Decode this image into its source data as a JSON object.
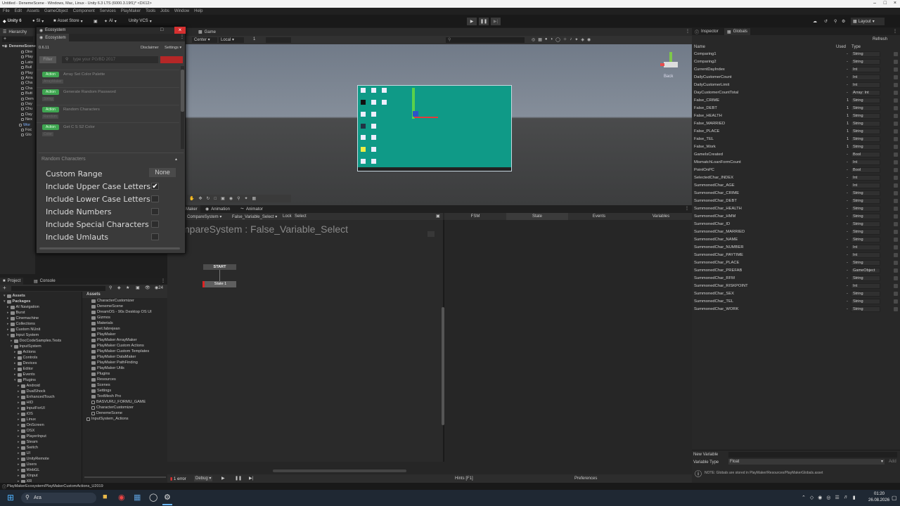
{
  "window": {
    "title": "Untitled - DenemeScene - Windows, Mac, Linux - Unity 6.3 LTS (6000.3.19f1)* <DX12>"
  },
  "menu": [
    "File",
    "Edit",
    "Assets",
    "GameObject",
    "Component",
    "Services",
    "PlayMaker",
    "Tools",
    "Jobs",
    "Window",
    "Help"
  ],
  "toolbar": {
    "unity": "Unity 6",
    "account": "SI",
    "asset_store": "Asset Store",
    "ai": "AI",
    "vcs": "Unity VCS",
    "layout": "Layout"
  },
  "hierarchy": {
    "tab": "Hierarchy",
    "root": "DenemeScene",
    "items": [
      "Dire",
      "Play",
      "Lato",
      "Buil",
      "Play",
      "Arra",
      "Cha",
      "Cha",
      "Butt",
      "Dem",
      "Day",
      "Chu",
      "Day",
      "Nex",
      "Wor",
      "Foc",
      "Glo"
    ]
  },
  "ecosystem": {
    "title": "Ecosystem",
    "tab": "Ecosystem",
    "version": "0.6.11",
    "disclaimer": "Disclaimer",
    "settings": "Settings",
    "filter": "Filter",
    "search_placeholder": "type your PG/BD 2017",
    "action_badge": "Action",
    "actions": [
      {
        "name": "Array Set Color Palette",
        "sub": "ArrayMaker"
      },
      {
        "name": "Generate Random Password",
        "sub": "String"
      },
      {
        "name": "Random Characters",
        "sub": "Random"
      },
      {
        "name": "Get C S S2 Color",
        "sub": "Color"
      }
    ],
    "section": "Random Characters",
    "custom_range": "Custom Range",
    "custom_range_value": "None",
    "options": [
      "Include Upper Case Letters",
      "Include Lower Case Letters",
      "Include Numbers",
      "Include Special Characters",
      "Include Umlauts"
    ],
    "checked": [
      true,
      false,
      false,
      false,
      false
    ]
  },
  "scene": {
    "game_tab": "Game",
    "center": "Center",
    "local": "Local",
    "num": "1",
    "back": "Back"
  },
  "playmaker": {
    "tabs": [
      "Maker",
      "Animation",
      "Animator"
    ],
    "fsm_select": "CompareSystem",
    "var_select": "False_Variable_Select",
    "lock": "Lock",
    "select": "Select",
    "title": "mpareSystem : False_Variable_Select",
    "start": "START",
    "state": "State 1",
    "right_tabs": [
      "FSM",
      "State",
      "Events",
      "Variables"
    ],
    "errors": "1 error",
    "debug": "Debug",
    "hints": "Hints [F1]",
    "preferences": "Preferences"
  },
  "project": {
    "tabs": [
      "Project",
      "Console"
    ],
    "count": "24",
    "breadcrumb": "Assets",
    "tree": [
      "Assets",
      "Packages",
      "AI Navigation",
      "Burst",
      "Cinemachine",
      "Collections",
      "Custom NUnit",
      "Input System",
      "DocCodeSamples.Tests",
      "InputSystem",
      "Actions",
      "Controls",
      "Devices",
      "Editor",
      "Events",
      "Plugins",
      "Android",
      "DualShock",
      "EnhancedTouch",
      "HID",
      "InputForUI",
      "iOS",
      "Linux",
      "OnScreen",
      "OSX",
      "PlayerInput",
      "Steam",
      "Switch",
      "UI",
      "UnityRemote",
      "Users",
      "WebGL",
      "XInput",
      "XR"
    ],
    "assets": [
      "CharacterCustomizer",
      "DenemeScene",
      "DreamOS - 90s Desktop OS UI",
      "Gizmos",
      "Materials",
      "net.fabrejean",
      "PlayMaker",
      "PlayMaker ArrayMaker",
      "PlayMaker Custom Actions",
      "PlayMaker Custom Templates",
      "PlayMaker DataMaker",
      "PlayMaker PathFinding",
      "PlayMaker Utils",
      "Plugins",
      "Resources",
      "Scenes",
      "Settings",
      "TextMesh Pro",
      "BASVURU_FORMU_GAME",
      "CharacterCustomizer",
      "DenemeScene",
      "InputSystem_Actions"
    ]
  },
  "status": {
    "path": "PlayMakerEcosystem/PlayMakerCustomActions_U2019"
  },
  "globals": {
    "tabs": [
      "Inspector",
      "Globals"
    ],
    "refresh": "Refresh",
    "col_name": "Name",
    "col_used": "Used",
    "col_type": "Type",
    "rows": [
      {
        "n": "Comparing1",
        "u": "-",
        "t": "String"
      },
      {
        "n": "Comparing2",
        "u": "-",
        "t": "String"
      },
      {
        "n": "CurrentDayIndex",
        "u": "-",
        "t": "Int"
      },
      {
        "n": "DailyCustomerCount",
        "u": "-",
        "t": "Int"
      },
      {
        "n": "DailyCustomerLimit",
        "u": "-",
        "t": "Int"
      },
      {
        "n": "DayCustomerCountTotal",
        "u": "-",
        "t": "Array: Int"
      },
      {
        "n": "False_CRIME",
        "u": "1",
        "t": "String"
      },
      {
        "n": "False_DEBT",
        "u": "1",
        "t": "String"
      },
      {
        "n": "False_HEALTH",
        "u": "1",
        "t": "String"
      },
      {
        "n": "False_MARRIED",
        "u": "1",
        "t": "String"
      },
      {
        "n": "False_PLACE",
        "u": "1",
        "t": "String"
      },
      {
        "n": "False_TEL",
        "u": "1",
        "t": "String"
      },
      {
        "n": "False_Work",
        "u": "1",
        "t": "String"
      },
      {
        "n": "GameIsCreated",
        "u": "-",
        "t": "Bool"
      },
      {
        "n": "MismatchLoanFormCount",
        "u": "-",
        "t": "Int"
      },
      {
        "n": "PointOnPC",
        "u": "-",
        "t": "Bool"
      },
      {
        "n": "SelectedChar_INDEX",
        "u": "-",
        "t": "Int"
      },
      {
        "n": "SummonedChar_AGE",
        "u": "-",
        "t": "Int"
      },
      {
        "n": "SummonedChar_CRIME",
        "u": "-",
        "t": "String"
      },
      {
        "n": "SummonedChar_DEBT",
        "u": "-",
        "t": "String"
      },
      {
        "n": "SummonedChar_HEALTH",
        "u": "-",
        "t": "String"
      },
      {
        "n": "SummonedChar_HMM",
        "u": "-",
        "t": "String"
      },
      {
        "n": "SummonedChar_ID",
        "u": "-",
        "t": "String"
      },
      {
        "n": "SummonedChar_MARRIED",
        "u": "-",
        "t": "String"
      },
      {
        "n": "SummonedChar_NAME",
        "u": "-",
        "t": "String"
      },
      {
        "n": "SummonedChar_NUMBER",
        "u": "-",
        "t": "Int"
      },
      {
        "n": "SummonedChar_PAYTIME",
        "u": "-",
        "t": "Int"
      },
      {
        "n": "SummonedChar_PLACE",
        "u": "-",
        "t": "String"
      },
      {
        "n": "SummonedChar_PREFAB",
        "u": "-",
        "t": "GameObject"
      },
      {
        "n": "SummonedChar_RFM",
        "u": "-",
        "t": "String"
      },
      {
        "n": "SummonedChar_RISKPOINT",
        "u": "-",
        "t": "Int"
      },
      {
        "n": "SummonedChar_SEX",
        "u": "-",
        "t": "String"
      },
      {
        "n": "SummonedChar_TEL",
        "u": "-",
        "t": "String"
      },
      {
        "n": "SummonedChar_WORK",
        "u": "-",
        "t": "String"
      }
    ],
    "new_variable": "New Variable",
    "variable_type": "Variable Type",
    "type_value": "Float",
    "add": "Add",
    "note": "NOTE: Globals are stored in PlayMaker/Resources/PlayMakerGlobals.asset"
  },
  "taskbar": {
    "search": "Ara",
    "time": "01:20",
    "date": "26.08.2026"
  }
}
